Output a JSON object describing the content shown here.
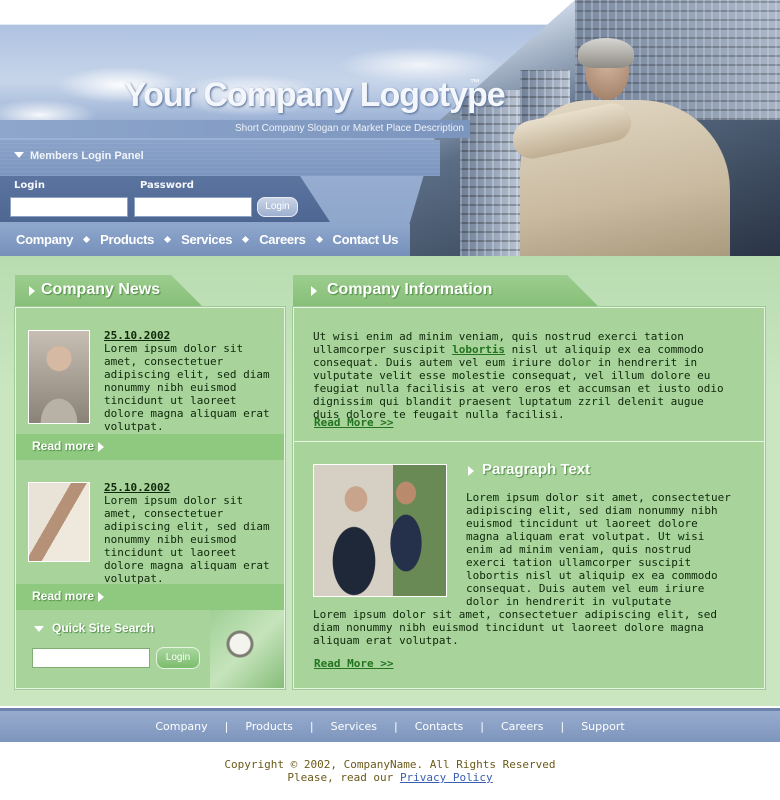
{
  "header": {
    "logo_text": "Your Company Logotype",
    "logo_tm": "™",
    "slogan": "Short Company Slogan or Market Place Description",
    "members_panel_label": "Members Login Panel",
    "login_label": "Login",
    "password_label": "Password",
    "login_button": "Login"
  },
  "nav": {
    "items": [
      "Company",
      "Products",
      "Services",
      "Careers",
      "Contact Us"
    ]
  },
  "news": {
    "title": "Company News",
    "items": [
      {
        "date": "25.10.2002",
        "text": "Lorem ipsum dolor sit amet, consectetuer adipiscing elit, sed diam nonummy nibh euismod tincidunt ut laoreet dolore magna aliquam erat volutpat."
      },
      {
        "date": "25.10.2002",
        "text": "Lorem ipsum dolor sit amet, consectetuer adipiscing elit, sed diam nonummy nibh euismod tincidunt ut laoreet dolore magna aliquam erat volutpat."
      }
    ],
    "read_more": "Read more"
  },
  "search": {
    "title": "Quick Site Search",
    "button": "Login"
  },
  "info": {
    "title": "Company Information",
    "text_before": "Ut wisi enim ad minim veniam, quis nostrud exerci tation ullamcorper suscipit ",
    "highlight": "lobortis",
    "text_after": " nisl ut aliquip ex ea commodo consequat. Duis autem vel eum iriure dolor in hendrerit in vulputate velit esse molestie consequat, vel illum dolore eu feugiat nulla facilisis at vero eros et accumsan et iusto odio dignissim qui blandit praesent luptatum zzril delenit augue duis dolore te feugait nulla facilisi.",
    "read_more": "Read More >>",
    "paragraph_title": "Paragraph Text",
    "paragraph_text": "Lorem ipsum dolor sit amet, consectetuer adipiscing elit, sed diam nonummy nibh euismod tincidunt ut laoreet dolore magna aliquam erat volutpat. Ut wisi enim ad minim veniam, quis nostrud exerci tation ullamcorper suscipit lobortis nisl ut aliquip ex ea commodo consequat. Duis autem vel eum iriure dolor in hendrerit in vulputate",
    "paragraph_text2": "Lorem ipsum dolor sit amet, consectetuer adipiscing elit, sed diam nonummy nibh euismod tincidunt ut laoreet dolore magna aliquam erat volutpat.",
    "read_more2": "Read More >>"
  },
  "footer": {
    "links": [
      "Company",
      "Products",
      "Services",
      "Contacts",
      "Careers",
      "Support"
    ],
    "copyright": "Copyright © 2002, CompanyName. All Rights Reserved",
    "privacy_prefix": "Please, read our ",
    "privacy_link": "Privacy Policy"
  },
  "colors": {
    "content_green": "#a8d49c",
    "header_blue": "#7d96bf",
    "link_green": "#237320"
  }
}
